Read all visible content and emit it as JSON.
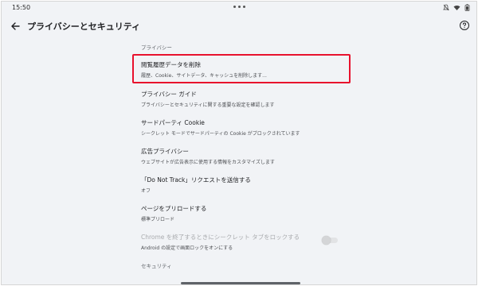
{
  "status": {
    "time": "15:50"
  },
  "appbar": {
    "title": "プライバシーとセキュリティ"
  },
  "sections": {
    "privacy_header": "プライバシー",
    "security_header": "セキュリティ"
  },
  "items": [
    {
      "title": "閲覧履歴データを削除",
      "subtitle": "履歴、Cookie、サイトデータ、キャッシュを削除します..."
    },
    {
      "title": "プライバシー ガイド",
      "subtitle": "プライバシーとセキュリティに関する重要な設定を確認します"
    },
    {
      "title": "サードパーティ Cookie",
      "subtitle": "シークレット モードでサードパーティの Cookie がブロックされています"
    },
    {
      "title": "広告プライバシー",
      "subtitle": "ウェブサイトが広告表示に使用する情報をカスタマイズします"
    },
    {
      "title": "「Do Not Track」リクエストを送信する",
      "subtitle": "オフ"
    },
    {
      "title": "ページをプリロードする",
      "subtitle": "標準プリロード"
    },
    {
      "title": "Chrome を終了するときにシークレット タブをロックする",
      "subtitle": "Android の設定で画面ロックをオンにする",
      "toggle_on": false
    }
  ],
  "icons": {
    "back": "arrow-back-icon",
    "help": "help-circle-icon",
    "mute": "bell-off-icon",
    "wifi": "wifi-icon",
    "battery": "battery-icon"
  },
  "colors": {
    "highlight": "#e8112d",
    "background": "#f1f3f6"
  }
}
